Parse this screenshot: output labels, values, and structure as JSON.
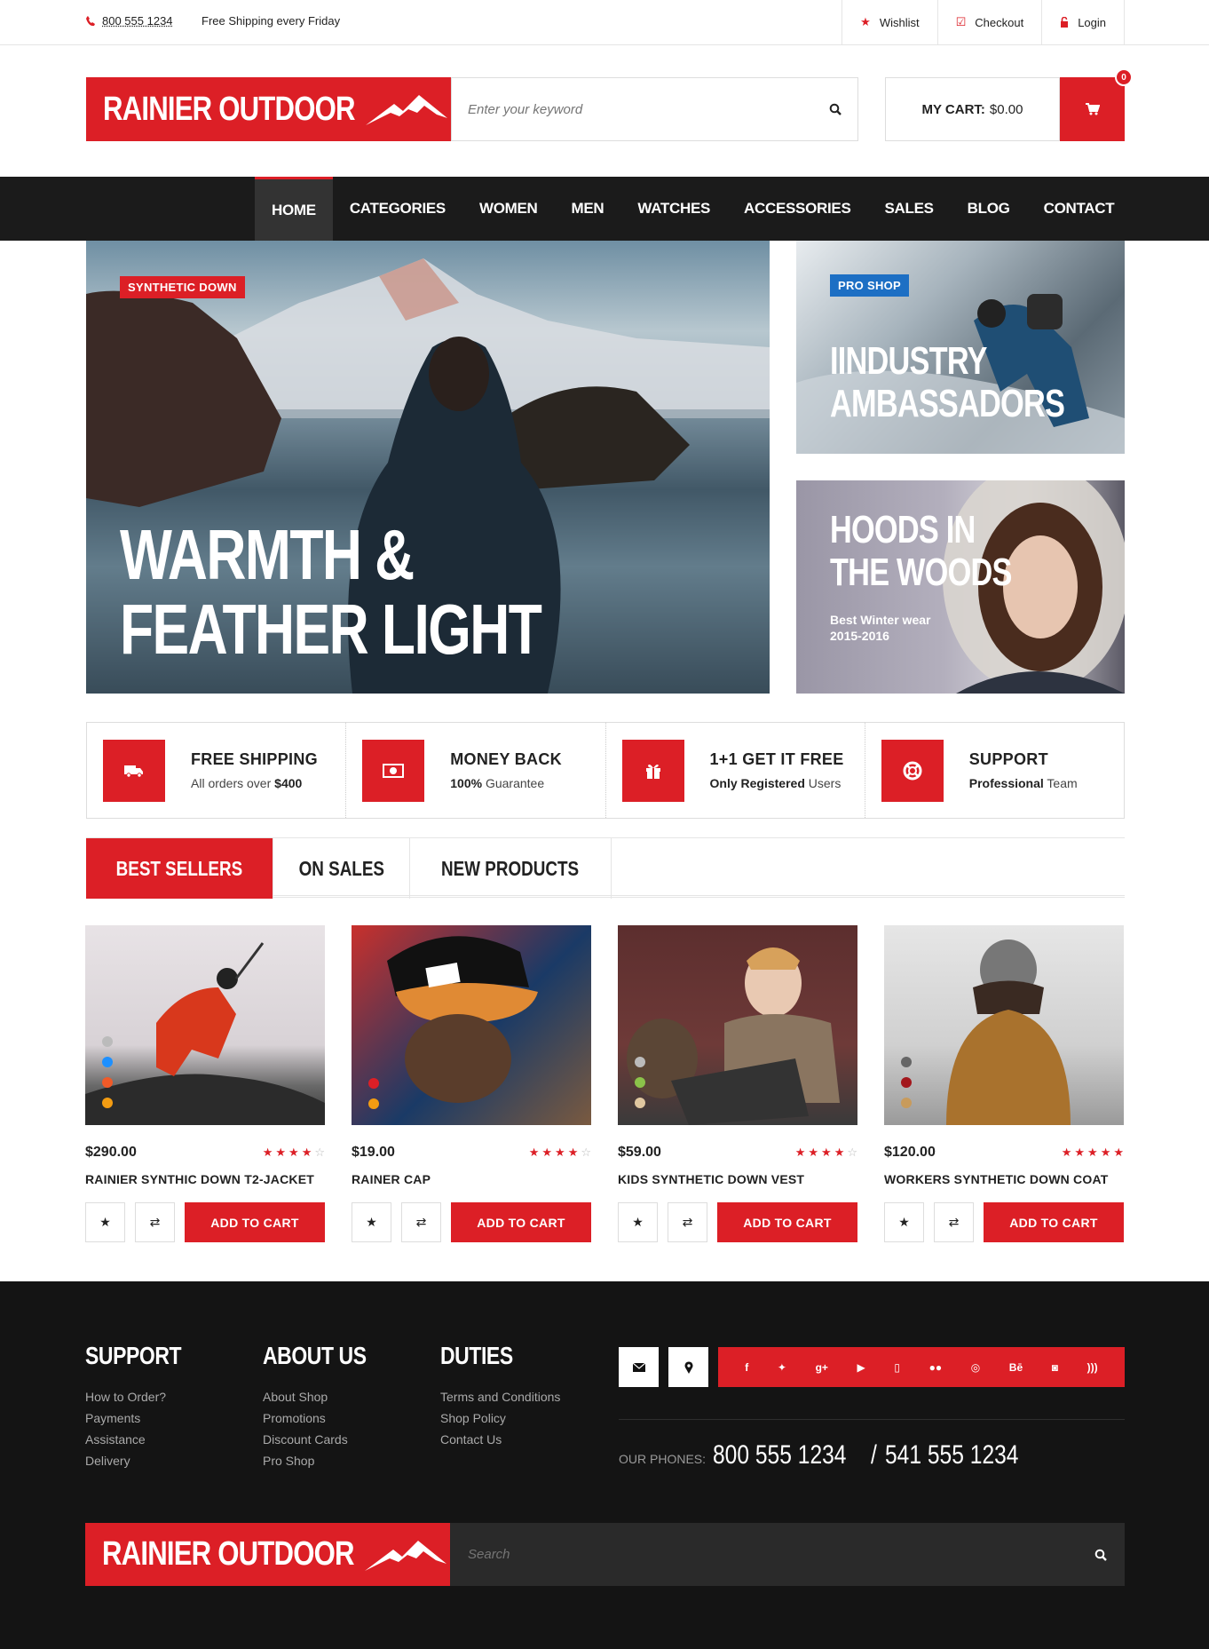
{
  "topbar": {
    "phone": "800 555 1234",
    "shipping": "Free Shipping every Friday",
    "links": [
      "Wishlist",
      "Checkout",
      "Login"
    ]
  },
  "header": {
    "logo": "RAINIER OUTDOOR",
    "search_placeholder": "Enter your keyword",
    "cart_label": "MY CART:",
    "cart_total": "$0.00",
    "cart_count": "0"
  },
  "nav": [
    "HOME",
    "CATEGORIES",
    "WOMEN",
    "MEN",
    "WATCHES",
    "ACCESSORIES",
    "SALES",
    "BLOG",
    "CONTACT"
  ],
  "hero": {
    "tag": "SYNTHETIC DOWN",
    "line1": "WARMTH &",
    "line2": "FEATHER LIGHT"
  },
  "side1": {
    "tag": "PRO SHOP",
    "line1": "IINDUSTRY",
    "line2": "AMBASSADORS"
  },
  "side2": {
    "line1": "HOODS IN",
    "line2": "THE WOODS",
    "sub1": "Best Winter wear",
    "sub2": "2015-2016"
  },
  "features": [
    {
      "title": "FREE SHIPPING",
      "sub_a": "All orders over ",
      "sub_b": "$400",
      "order": "normal-bold"
    },
    {
      "title": "MONEY BACK",
      "sub_a": "100%",
      "sub_b": " Guarantee",
      "order": "bold-normal"
    },
    {
      "title": "1+1 GET IT FREE",
      "sub_a": "Only Registered",
      "sub_b": " Users",
      "order": "bold-normal"
    },
    {
      "title": "SUPPORT",
      "sub_a": "Professional",
      "sub_b": " Team",
      "order": "bold-normal"
    }
  ],
  "tabs": [
    "BEST SELLERS",
    "ON SALES",
    "NEW PRODUCTS"
  ],
  "products": [
    {
      "price": "$290.00",
      "name": "RAINIER SYNTHIC DOWN T2-JACKET",
      "rating": 4,
      "add": "ADD TO CART"
    },
    {
      "price": "$19.00",
      "name": "RAINER CAP",
      "rating": 4,
      "add": "ADD TO CART"
    },
    {
      "price": "$59.00",
      "name": "KIDS SYNTHETIC DOWN VEST",
      "rating": 4,
      "add": "ADD TO CART"
    },
    {
      "price": "$120.00",
      "name": "WORKERS SYNTHETIC DOWN COAT",
      "rating": 5,
      "add": "ADD TO CART"
    }
  ],
  "footer": {
    "support": {
      "title": "SUPPORT",
      "links": [
        "How to Order?",
        "Payments",
        "Assistance",
        "Delivery"
      ]
    },
    "about": {
      "title": "ABOUT US",
      "links": [
        "About Shop",
        "Promotions",
        "Discount Cards",
        "Pro Shop"
      ]
    },
    "duties": {
      "title": "DUTIES",
      "links": [
        "Terms and Conditions",
        "Shop Policy",
        "Contact Us"
      ]
    },
    "phones_label": "OUR PHONES:",
    "phone1": "800 555 1234",
    "phone_sep": "/",
    "phone2": "541 555 1234",
    "search_placeholder": "Search"
  },
  "colors": {
    "accent": "#dc1f26",
    "nav_bg": "#1b1b1b",
    "footer_bg": "#141414",
    "tag_blue": "#1d6fc4"
  },
  "social_icons": [
    "facebook-icon",
    "twitter-icon",
    "google-plus-icon",
    "youtube-icon",
    "mobile-icon",
    "flickr-icon",
    "dribbble-icon",
    "behance-icon",
    "instagram-icon",
    "rss-icon"
  ]
}
